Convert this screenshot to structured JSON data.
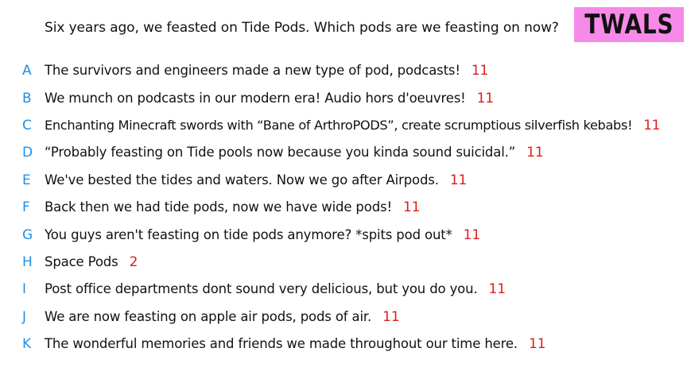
{
  "question": "Six years ago, we feasted on Tide Pods. Which pods are we feasting on now?",
  "logo": "TWALS",
  "answers": [
    {
      "letter": "A",
      "text": "The survivors and engineers made a new type of pod, podcasts!",
      "count": "11"
    },
    {
      "letter": "B",
      "text": "We munch on podcasts in our modern era! Audio hors d'oeuvres!",
      "count": "11"
    },
    {
      "letter": "C",
      "text": "Enchanting Minecraft swords with “Bane of ArthroPODS”, create scrumptious silverfish kebabs!",
      "count": "11"
    },
    {
      "letter": "D",
      "text": "“Probably feasting on Tide pools now because you kinda sound suicidal.”",
      "count": "11"
    },
    {
      "letter": "E",
      "text": "We've bested the tides and waters. Now we go after Airpods.",
      "count": "11"
    },
    {
      "letter": "F",
      "text": "Back then we had tide pods, now we have wide pods!",
      "count": "11"
    },
    {
      "letter": "G",
      "text": "You guys aren't feasting on tide pods anymore? *spits pod out*",
      "count": "11"
    },
    {
      "letter": "H",
      "text": "Space Pods",
      "count": "2"
    },
    {
      "letter": "I",
      "text": "Post office departments dont sound very delicious, but you do you.",
      "count": "11"
    },
    {
      "letter": "J",
      "text": "We are now feasting on apple air pods, pods of air.",
      "count": "11"
    },
    {
      "letter": "K",
      "text": "The wonderful memories and friends we made throughout our time here.",
      "count": "11"
    }
  ],
  "colors": {
    "letter": "#1f8fe6",
    "count": "#e01b1b",
    "logo_bg": "#f78ae8"
  }
}
